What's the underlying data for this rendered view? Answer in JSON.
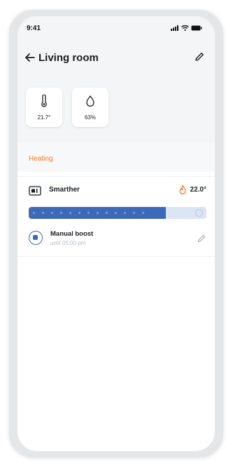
{
  "status_bar": {
    "time": "9:41"
  },
  "header": {
    "title": "Living room"
  },
  "sensors": [
    {
      "value": "21.7°",
      "icon": "thermometer-icon"
    },
    {
      "value": "63%",
      "icon": "humidity-drop-icon"
    }
  ],
  "section": {
    "label": "Heating"
  },
  "device": {
    "name": "Smarther",
    "temperature": "22.0°",
    "progress_fraction": 0.77
  },
  "boost": {
    "title": "Manual boost",
    "subtitle": "until 05:00 pm"
  },
  "colors": {
    "accent_orange": "#f07a23",
    "accent_blue": "#3d6ab8",
    "track_blue": "#dbe5f3"
  }
}
